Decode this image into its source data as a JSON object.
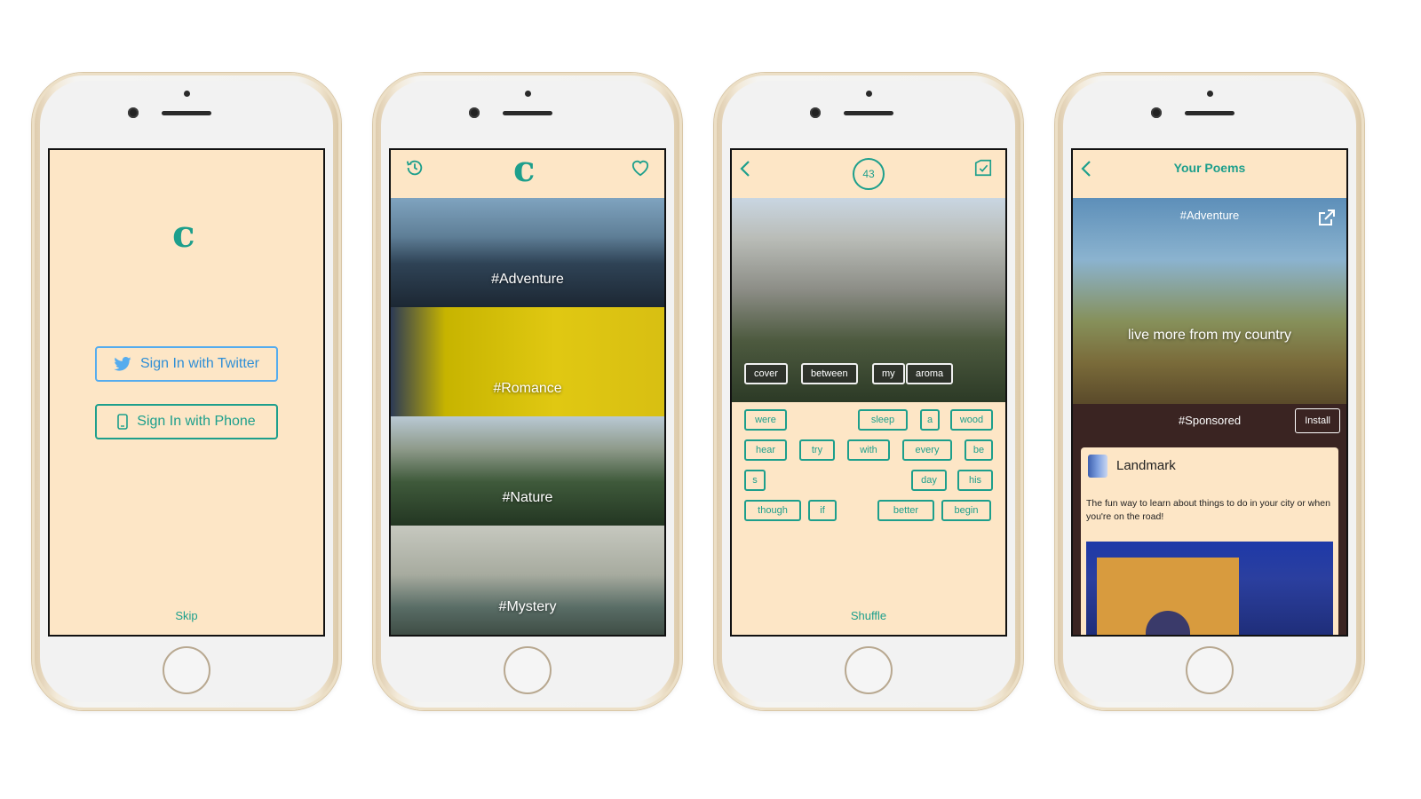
{
  "colors": {
    "accent": "#1d9f8c",
    "screen_bg": "#fde6c6",
    "twitter_blue": "#55acee",
    "sponsored_bg": "#3a2422"
  },
  "screen1": {
    "logo": "c",
    "twitter_button": "Sign In with Twitter",
    "phone_button": "Sign In with Phone",
    "skip": "Skip"
  },
  "screen2": {
    "logo": "c",
    "categories": [
      "#Adventure",
      "#Romance",
      "#Nature",
      "#Mystery"
    ]
  },
  "screen3": {
    "timer": "43",
    "placed_words": [
      "cover",
      "between",
      "my",
      "aroma"
    ],
    "word_tiles": [
      "were",
      "sleep",
      "a",
      "wood",
      "hear",
      "try",
      "with",
      "every",
      "be",
      "s",
      "day",
      "his",
      "though",
      "if",
      "better",
      "begin"
    ],
    "shuffle": "Shuffle"
  },
  "screen4": {
    "title": "Your Poems",
    "tag": "#Adventure",
    "poem": "live more from my country",
    "sponsored": "#Sponsored",
    "install": "Install",
    "ad_title": "Landmark",
    "ad_description": "The fun way to learn about things to do in your city or when you're on the road!"
  }
}
